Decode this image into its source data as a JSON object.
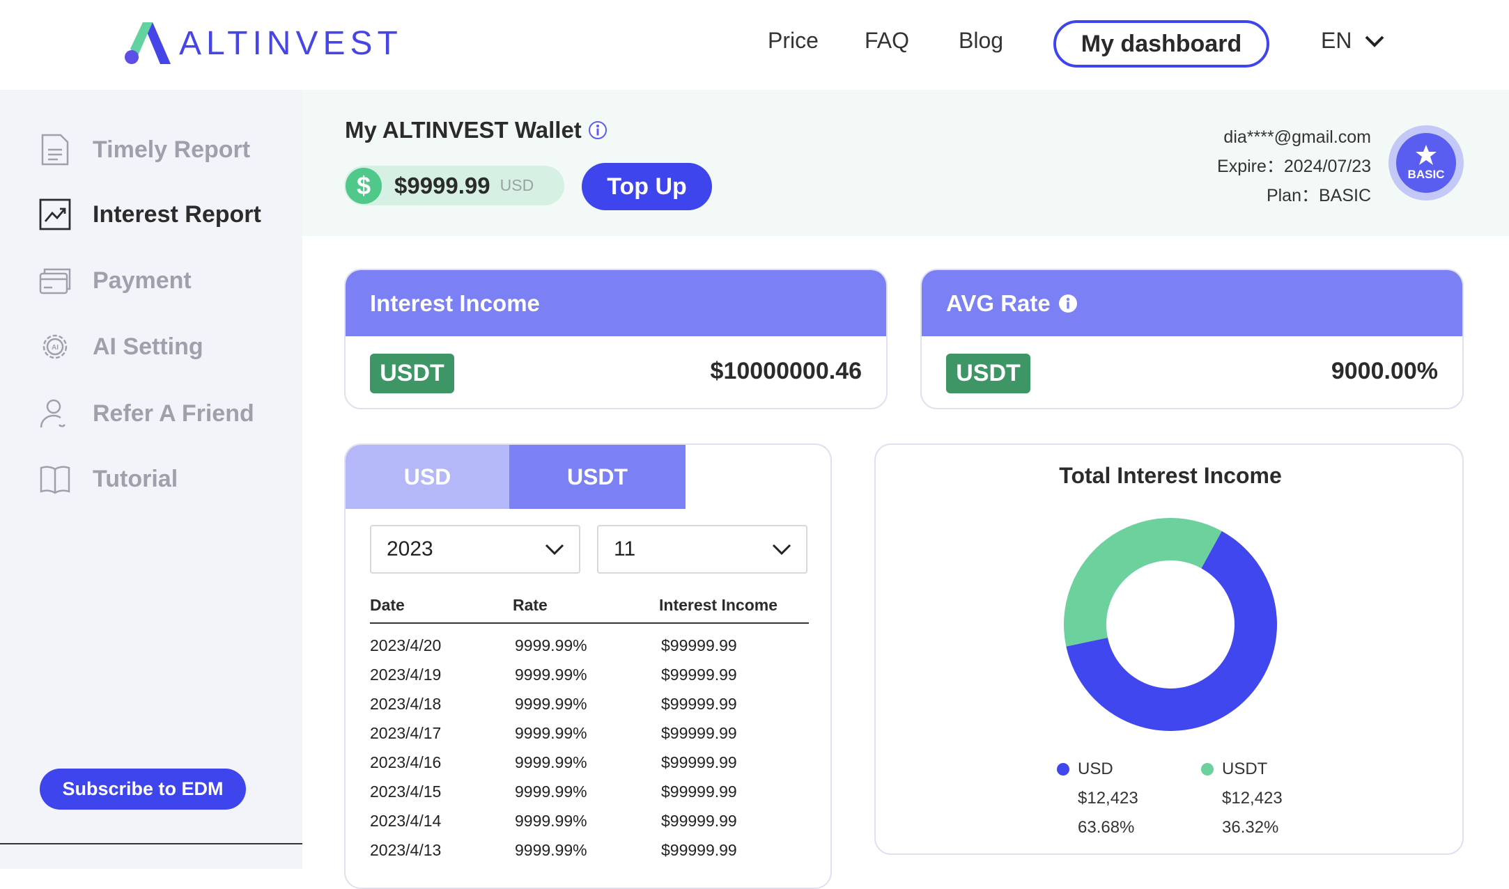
{
  "brand": {
    "name": "ALTINVEST"
  },
  "nav": {
    "price": "Price",
    "faq": "FAQ",
    "blog": "Blog",
    "dashboard": "My dashboard",
    "lang": "EN"
  },
  "sidebar": {
    "items": [
      {
        "label": "Timely Report",
        "icon": "document-icon"
      },
      {
        "label": "Interest Report",
        "icon": "trend-chart-icon"
      },
      {
        "label": "Payment",
        "icon": "credit-card-icon"
      },
      {
        "label": "AI Setting",
        "icon": "ai-gear-icon"
      },
      {
        "label": "Refer A Friend",
        "icon": "user-icon"
      },
      {
        "label": "Tutorial",
        "icon": "book-icon"
      }
    ],
    "subscribe": "Subscribe to EDM"
  },
  "wallet": {
    "title": "My ALTINVEST Wallet",
    "balance": "$9999.99",
    "currency": "USD",
    "topup": "Top Up"
  },
  "user": {
    "email": "dia****@gmail.com",
    "expire": "Expire：2024/07/23",
    "plan": "Plan：BASIC",
    "badge": "BASIC"
  },
  "cards": {
    "interest": {
      "title": "Interest Income",
      "tag": "USDT",
      "value": "$10000000.46"
    },
    "avg": {
      "title": "AVG Rate",
      "tag": "USDT",
      "value": "9000.00%"
    }
  },
  "table": {
    "tabs": [
      "USD",
      "USDT"
    ],
    "year": "2023",
    "month": "11",
    "headers": [
      "Date",
      "Rate",
      "Interest Income"
    ],
    "rows": [
      [
        "2023/4/20",
        "9999.99%",
        "$99999.99"
      ],
      [
        "2023/4/19",
        "9999.99%",
        "$99999.99"
      ],
      [
        "2023/4/18",
        "9999.99%",
        "$99999.99"
      ],
      [
        "2023/4/17",
        "9999.99%",
        "$99999.99"
      ],
      [
        "2023/4/16",
        "9999.99%",
        "$99999.99"
      ],
      [
        "2023/4/15",
        "9999.99%",
        "$99999.99"
      ],
      [
        "2023/4/14",
        "9999.99%",
        "$99999.99"
      ],
      [
        "2023/4/13",
        "9999.99%",
        "$99999.99"
      ]
    ]
  },
  "chart_data": {
    "type": "pie",
    "title": "Total Interest Income",
    "series": [
      {
        "name": "USD",
        "amount": "$12,423",
        "percent_label": "63.68%",
        "value": 63.68,
        "color": "#4047ee"
      },
      {
        "name": "USDT",
        "amount": "$12,423",
        "percent_label": "36.32%",
        "value": 36.32,
        "color": "#6dd19d"
      }
    ]
  },
  "colors": {
    "accent": "#3f45ec",
    "card_header": "#7b81f4",
    "tag_green": "#3e9666"
  }
}
